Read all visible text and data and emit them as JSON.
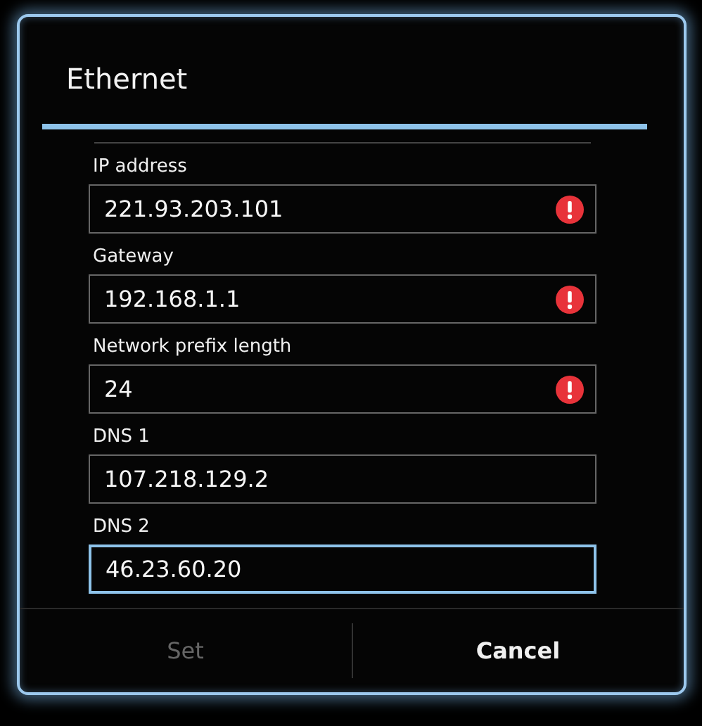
{
  "dialog": {
    "title": "Ethernet"
  },
  "fields": [
    {
      "label": "IP address",
      "value": "221.93.203.101",
      "error": true,
      "focused": false
    },
    {
      "label": "Gateway",
      "value": "192.168.1.1",
      "error": true,
      "focused": false
    },
    {
      "label": "Network prefix length",
      "value": "24",
      "error": true,
      "focused": false
    },
    {
      "label": "DNS 1",
      "value": "107.218.129.2",
      "error": false,
      "focused": false
    },
    {
      "label": "DNS 2",
      "value": "46.23.60.20",
      "error": false,
      "focused": true
    }
  ],
  "buttons": [
    {
      "label": "Set",
      "disabled": true
    },
    {
      "label": "Cancel",
      "disabled": false
    }
  ]
}
